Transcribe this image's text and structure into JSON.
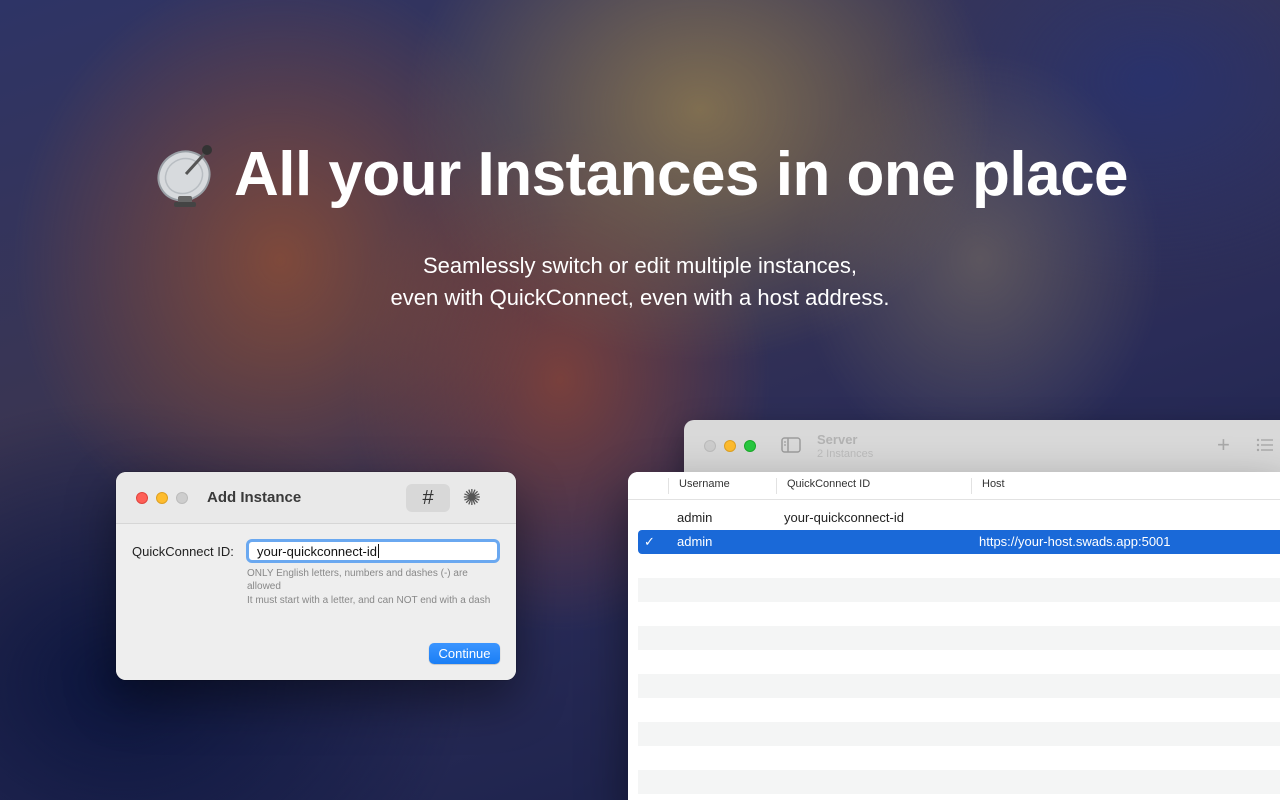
{
  "hero": {
    "title": "All your Instances in one place",
    "subtitle_line1": "Seamlessly switch or edit multiple instances,",
    "subtitle_line2": "even with QuickConnect, even with a host address.",
    "icon": "satellite-dish-icon"
  },
  "add_instance_dialog": {
    "title": "Add Instance",
    "mode_buttons": [
      {
        "label": "#",
        "icon": "hash-icon",
        "selected": true
      },
      {
        "label": "✺",
        "icon": "sparkle-icon",
        "selected": false
      }
    ],
    "field_label": "QuickConnect ID:",
    "field_value": "your-quickconnect-id",
    "hint_line1": "ONLY English letters, numbers and dashes (-) are allowed",
    "hint_line2": "It must start with a letter, and can NOT end with a dash",
    "continue_label": "Continue"
  },
  "server_window": {
    "title": "Server",
    "subtitle": "2 Instances",
    "columns": [
      "Username",
      "QuickConnect ID",
      "Host"
    ],
    "rows": [
      {
        "checked": "",
        "username": "admin",
        "quickconnect_id": "your-quickconnect-id",
        "host": ""
      },
      {
        "checked": "✓",
        "username": "admin",
        "quickconnect_id": "",
        "host": "https://your-host.swads.app:5001"
      }
    ],
    "selection_color": "#1a69d8"
  }
}
